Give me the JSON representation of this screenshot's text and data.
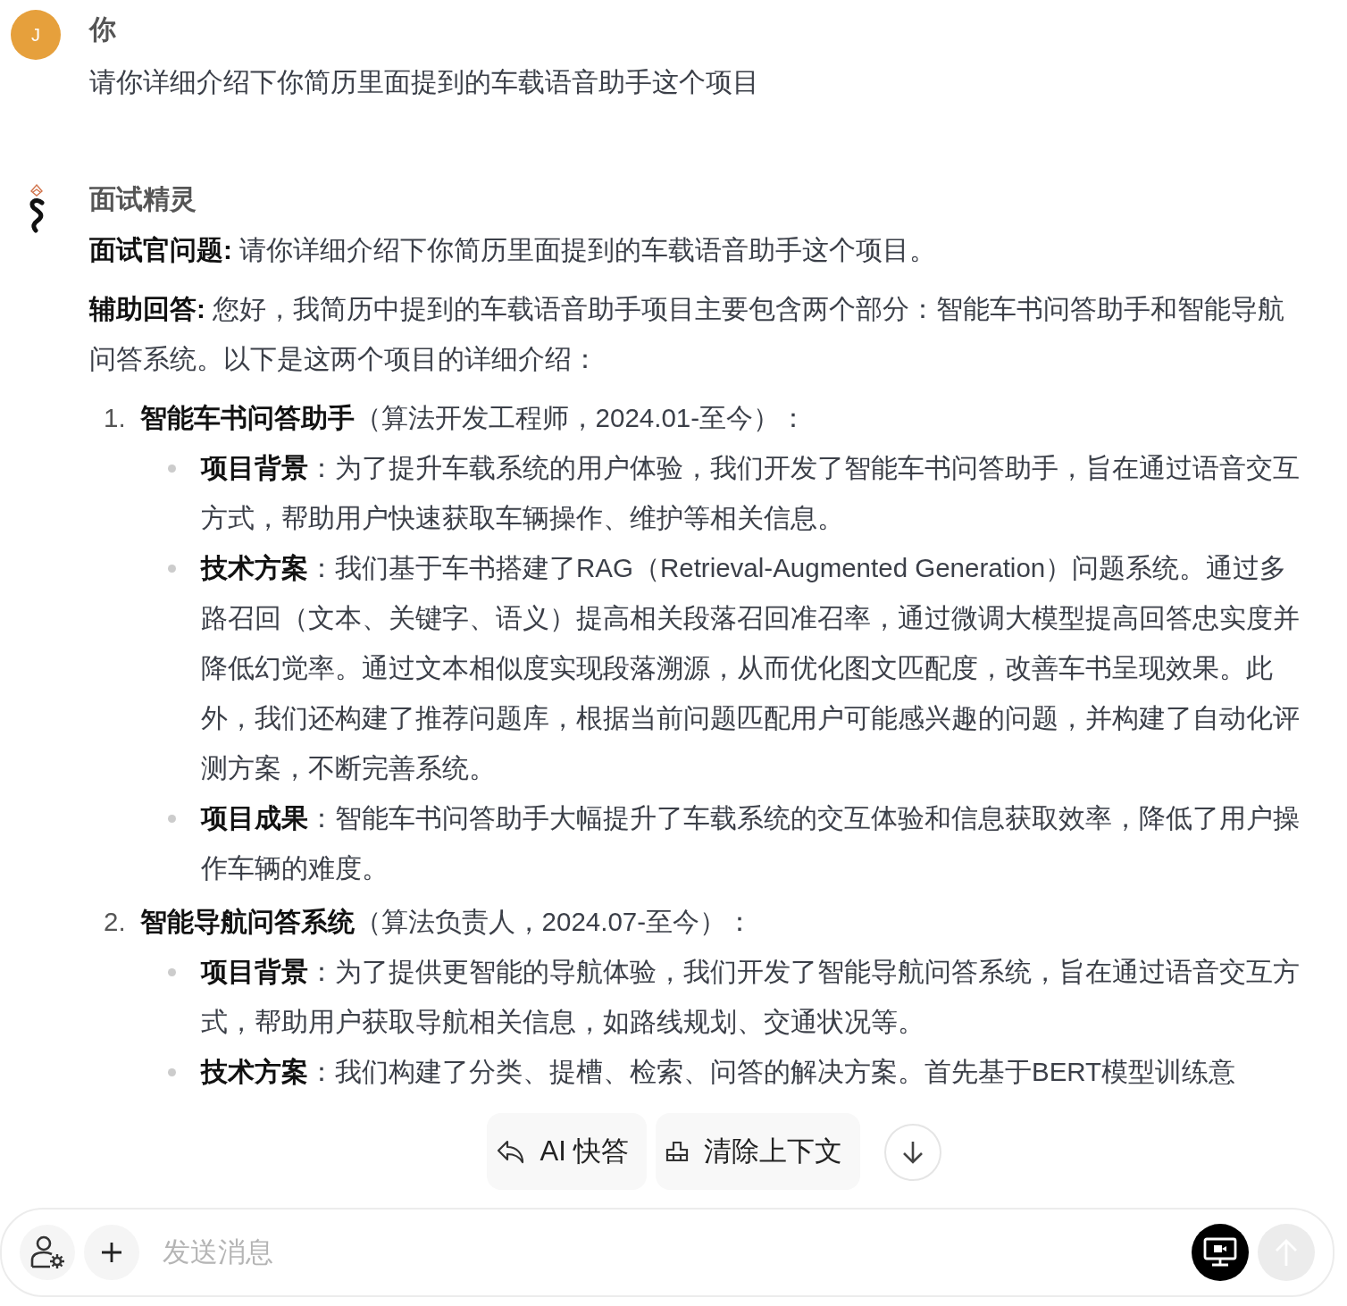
{
  "user_message": {
    "avatar_letter": "J",
    "name": "你",
    "text": "请你详细介绍下你简历里面提到的车载语音助手这个项目"
  },
  "assistant_message": {
    "name": "面试精灵",
    "paragraphs": [
      {
        "text": "**面试官问题:** 请你详细介绍下你简历里面提到的车载语音助手这个项目。"
      },
      {
        "text": "**辅助回答:** 您好，我简历中提到的车载语音助手项目主要包含两个部分：智能车书问答助手和智能导航问答系统。以下是这两个项目的详细介绍："
      }
    ],
    "projects": [
      {
        "number": "1.",
        "title": "**智能车书问答助手**（算法开发工程师，2024.01-至今）：",
        "bullets": [
          {
            "text": "**项目背景**：为了提升车载系统的用户体验，我们开发了智能车书问答助手，旨在通过语音交互方式，帮助用户快速获取车辆操作、维护等相关信息。"
          },
          {
            "text": "**技术方案**：我们基于车书搭建了RAG（Retrieval-Augmented Generation）问题系统。通过多路召回（文本、关键字、语义）提高相关段落召回准召率，通过微调大模型提高回答忠实度并降低幻觉率。通过文本相似度实现段落溯源，从而优化图文匹配度，改善车书呈现效果。此外，我们还构建了推荐问题库，根据当前问题匹配用户可能感兴趣的问题，并构建了自动化评测方案，不断完善系统。"
          },
          {
            "text": "**项目成果**：智能车书问答助手大幅提升了车载系统的交互体验和信息获取效率，降低了用户操作车辆的难度。"
          }
        ]
      },
      {
        "number": "2.",
        "title": "**智能导航问答系统**（算法负责人，2024.07-至今）：",
        "bullets": [
          {
            "text": "**项目背景**：为了提供更智能的导航体验，我们开发了智能导航问答系统，旨在通过语音交互方式，帮助用户获取导航相关信息，如路线规划、交通状况等。"
          },
          {
            "text": "**技术方案**：我们构建了分类、提槽、检索、问答的解决方案。首先基于BERT模型训练意"
          }
        ]
      }
    ]
  },
  "quick_actions": [
    {
      "kind": "reply",
      "label": "AI 快答"
    },
    {
      "kind": "broom",
      "label": "清除上下文"
    }
  ],
  "composer": {
    "placeholder": "发送消息"
  }
}
